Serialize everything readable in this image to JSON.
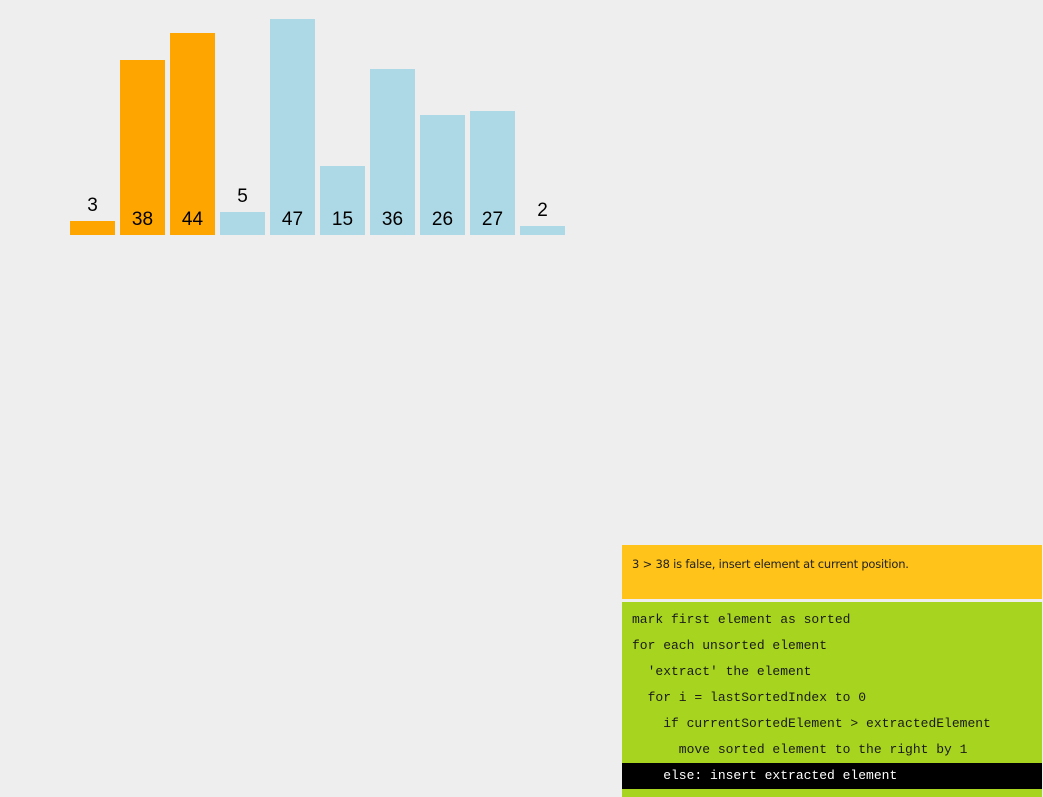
{
  "bars": [
    {
      "value": 3,
      "state": "sorted"
    },
    {
      "value": 38,
      "state": "sorted"
    },
    {
      "value": 44,
      "state": "sorted"
    },
    {
      "value": 5,
      "state": "unsorted"
    },
    {
      "value": 47,
      "state": "unsorted"
    },
    {
      "value": 15,
      "state": "unsorted"
    },
    {
      "value": 36,
      "state": "unsorted"
    },
    {
      "value": 26,
      "state": "unsorted"
    },
    {
      "value": 27,
      "state": "unsorted"
    },
    {
      "value": 2,
      "state": "unsorted"
    }
  ],
  "colors": {
    "sorted": "#ffa500",
    "unsorted": "#add8e6",
    "status_bg": "#ffc319",
    "code_bg": "#a6d41f",
    "active_line_bg": "#000000"
  },
  "status": {
    "text": "3 > 38 is false, insert element at current position."
  },
  "code": {
    "lines": [
      "mark first element as sorted",
      "for each unsorted element",
      "  'extract' the element",
      "  for i = lastSortedIndex to 0",
      "    if currentSortedElement > extractedElement",
      "      move sorted element to the right by 1",
      "    else: insert extracted element"
    ],
    "active_line": 6
  }
}
